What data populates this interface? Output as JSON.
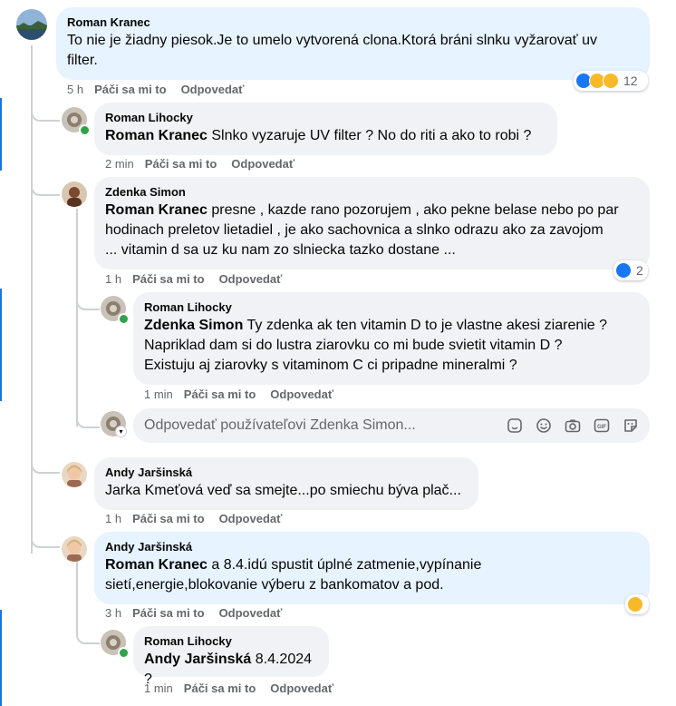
{
  "colors": {
    "accent": "#1b74e4",
    "bubble": "#f0f2f5",
    "bubble_highlight": "#e7f3ff",
    "muted": "#65676b"
  },
  "actions": {
    "like": "Páči sa mi to",
    "reply": "Odpovedať"
  },
  "comments": [
    {
      "author": "Roman Kranec",
      "mention": "",
      "lines": [
        "To nie je žiadny piesok.Je to umelo vytvorená clona.Ktorá bráni slnku vyžarovať uv",
        "filter."
      ],
      "time": "5 h",
      "reactions": {
        "icons": [
          "like-icon",
          "haha-icon",
          "wow-icon"
        ],
        "count": "12"
      }
    },
    {
      "author": "Roman Lihocky",
      "mention": "Roman Kranec",
      "lines": [
        " Slnko vyzaruje UV filter ? No do riti a ako to robi ?"
      ],
      "time": "2 min"
    },
    {
      "author": "Zdenka Simon",
      "mention": "Roman Kranec",
      "lines": [
        " presne , kazde rano pozorujem , ako pekne belase nebo po par",
        "hodinach preletov lietadiel , je ako sachovnica a slnko odrazu ako za zavojom",
        "... vitamin d sa uz ku nam zo slniecka tazko dostane ..."
      ],
      "time": "1 h",
      "reactions": {
        "icons": [
          "like-icon"
        ],
        "count": "2"
      }
    },
    {
      "author": "Roman Lihocky",
      "mention": "Zdenka Simon",
      "lines": [
        " Ty zdenka ak ten vitamin D to je vlastne akesi ziarenie ?",
        "Napriklad dam si do lustra ziarovku co mi bude svietit vitamin D ?",
        "Existuju aj ziarovky s vitaminom C ci pripadne mineralmi ?"
      ],
      "time": "1 min"
    },
    {
      "author": "Andy Jaršinská",
      "mention": "",
      "lines": [
        "Jarka Kmeťová veď sa smejte...po smiechu býva plač..."
      ],
      "time": "1 h"
    },
    {
      "author": "Andy Jaršinská",
      "mention": "Roman Kranec",
      "lines": [
        " a 8.4.idú spustit úplné zatmenie,vypínanie",
        "sietí,energie,blokovanie výberu z bankomatov a pod."
      ],
      "time": "3 h",
      "reactions": {
        "icons": [
          "haha-icon"
        ],
        "count": ""
      }
    },
    {
      "author": "Roman Lihocky",
      "mention": "Andy Jaršinská",
      "lines": [
        " 8.4.2024 ?"
      ],
      "time": "1 min"
    }
  ],
  "reply_box": {
    "placeholder": "Odpovedať používateľovi Zdenka Simon..."
  }
}
